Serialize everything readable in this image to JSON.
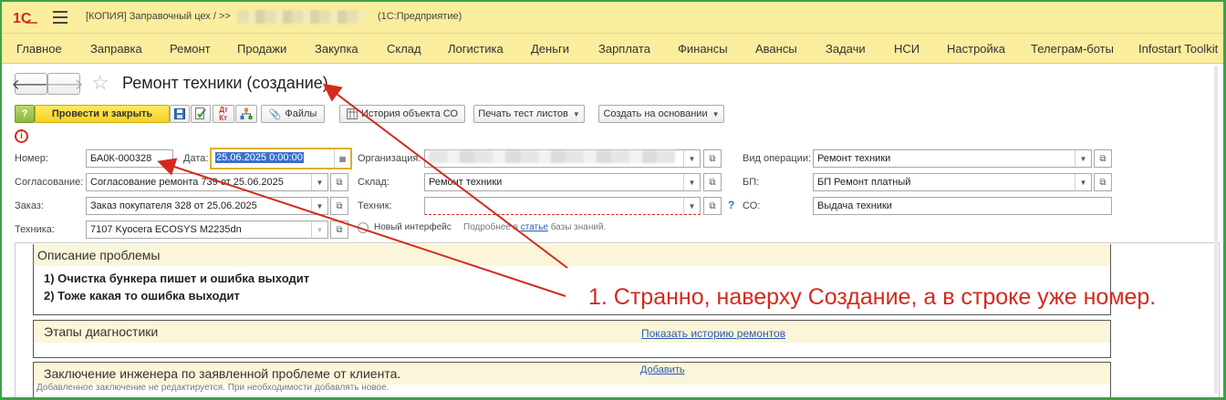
{
  "window": {
    "title": "[КОПИЯ] Заправочный цех /",
    "title_sep": ">>",
    "app": "(1С:Предприятие)"
  },
  "menu": [
    "Главное",
    "Заправка",
    "Ремонт",
    "Продажи",
    "Закупка",
    "Склад",
    "Логистика",
    "Деньги",
    "Зарплата",
    "Финансы",
    "Авансы",
    "Задачи",
    "НСИ",
    "Настройка",
    "Телеграм-боты",
    "Infostart Toolkit"
  ],
  "form": {
    "title": "Ремонт техники (создание)"
  },
  "toolbar": {
    "help_label": "?",
    "post_close": "Провести и закрыть",
    "files": "Файлы",
    "history": "История объекта СО",
    "print": "Печать тест листов",
    "create_based": "Создать на основании"
  },
  "fields": {
    "number_label": "Номер:",
    "number_value": "БА0К-000328",
    "date_label": "Дата:",
    "date_value": "25.06.2025  0:00:00",
    "org_label": "Организация:",
    "operation_label": "Вид операции:",
    "operation_value": "Ремонт техники",
    "approval_label": "Согласование:",
    "approval_value": "Согласование ремонта 739 от 25.06.2025",
    "warehouse_label": "Склад:",
    "warehouse_value": "Ремонт техники",
    "bp_label": "БП:",
    "bp_value": "БП Ремонт платный",
    "order_label": "Заказ:",
    "order_value": "Заказ покупателя 328 от 25.06.2025",
    "technician_label": "Техник:",
    "technician_value": "",
    "co_label": "СО:",
    "co_value": "Выдача техники",
    "equipment_label": "Техника:",
    "equipment_value": "7107 Kyocera ECOSYS M2235dn",
    "new_interface": "Новый интерфейс",
    "hint_pre": "Подробнее в",
    "hint_link": "статье",
    "hint_post": "базы знаний."
  },
  "sections": {
    "problem_title": "Описание проблемы",
    "problem_lines": [
      "1) Очистка бункера пишет и ошибка выходит",
      "2) Тоже какая то ошибка выходит"
    ],
    "diag_title": "Этапы диагностики",
    "diag_link": "Показать историю ремонтов",
    "conclusion_title": "Заключение инженера по заявленной проблеме от клиента.",
    "conclusion_link": "Добавить",
    "conclusion_note": "Добавленное заключение не редактируется. При необходимости добавлять новое."
  },
  "annotation": "1. Странно, наверху Создание, а в строке уже номер.",
  "colors": {
    "header_bg": "#fbed9e",
    "annotation": "#d42a1e",
    "frame": "#3fa04a",
    "primary_button": "#f6d220"
  }
}
